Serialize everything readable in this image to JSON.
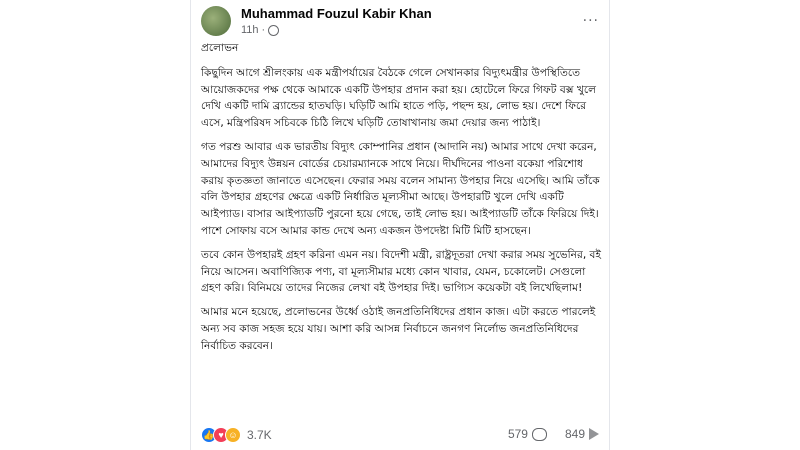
{
  "post": {
    "author": "Muhammad Fouzul Kabir Khan",
    "time": "11h",
    "more": "...",
    "title": "প্রলোভন",
    "paragraphs": [
      "কিছুদিন আগে শ্রীলংকায় এক মন্ত্রীপর্যায়ের বৈঠকে গেলে সেখানকার বিদ্যুৎমন্ত্রীর উপস্থিতিতে আয়োজকদের পক্ষ থেকে আমাকে একটি উপহার প্রদান করা হয়। হোটেলে ফিরে গিফট বক্স খুলে দেখি একটি দামি ব্র্যান্ডের হাতঘড়ি। ঘড়িটি আমি হাতে পড়ি, পছন্দ হয়, লোভ হয়। দেশে ফিরে এসে, মন্ত্রিপরিষদ সচিবকে চিঠি লিখে ঘড়িটি তোষাখানায় জমা দেয়ার জন্য পাঠাই।",
      "গত পরশু আবার এক ভারতীয় বিদ্যুৎ কোম্পানির প্রধান (আদানি নয়) আমার সাথে দেখা করেন, আমাদের বিদ্যুৎ উন্নয়ন বোর্ডের চেয়ারম্যানকে সাথে নিয়ে। দীর্ঘদিনের পাওনা বকেয়া পরিশোধ করায় কৃতজ্ঞতা জানাতে এসেছেন। ফেরার সময় বলেন সামান্য উপহার নিয়ে এসেছি। আমি তাঁকে বলি উপহার গ্রহণের ক্ষেত্রে একটি নির্ধারিত মূল্যসীমা আছে। উপহারটি খুলে দেখি একটি আইপ্যাড। বাসার আইপ্যাডটি পুরনো হয়ে গেছে, তাই লোভ হয়। আইপ্যাডটি তাঁকে ফিরিয়ে দিই। পাশে সোফায় বসে আমার কান্ড দেখে অন্য একজন উপদেষ্টা মিটি মিটি হাসছেন।",
      "তবে কোন উপহারই গ্রহণ করিনা এমন নয়। বিদেশী মন্ত্রী, রাষ্ট্রদূতরা দেখা করার সময় সুভেনির, বই নিয়ে আসেন। অবাণিজ্যিক পণ্য, বা মূল্যসীমার মধ্যে কোন খাবার, যেমন, চকোলেট। সেগুলো গ্রহণ করি। বিনিময়ে তাদের নিজের লেখা বই উপহার দিই। ভাগ্যিস কয়েকটা বই লিখেছিলাম!",
      "আমার মনে হয়েছে, প্রলোভনের উর্ধ্বে ওঠাই জনপ্রতিনিধিদের প্রধান কাজ। এটা করতে পারলেই অন্য সব কাজ সহজ হয়ে যায়। আশা করি আসন্ন নির্বাচনে জনগণ নির্লোভ জনপ্রতিনিধিদের নির্বাচিত করবেন।"
    ]
  },
  "footer": {
    "reactions_count": "3.7K",
    "comments_count": "579",
    "shares_count": "849"
  },
  "colors": {
    "like": "#1877f2",
    "love": "#f33e58",
    "haha": "#f7b125",
    "secondary_text": "#65676b"
  }
}
